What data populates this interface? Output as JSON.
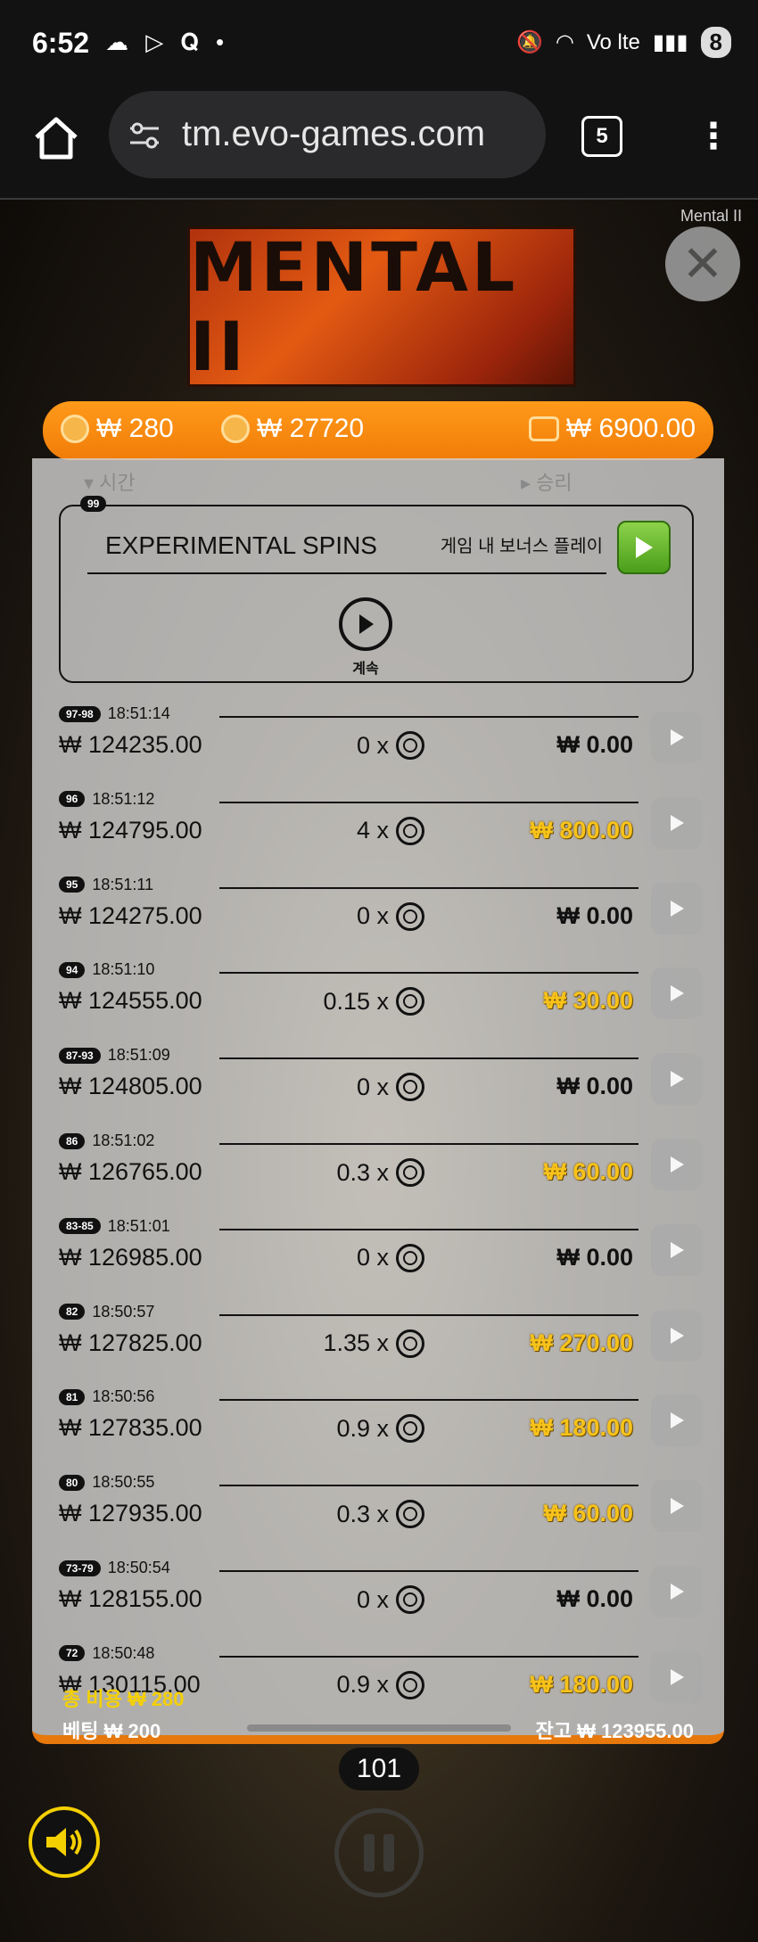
{
  "status_bar": {
    "time": "6:52",
    "notif_icons": "☁ ▷ 𝐐 •",
    "network": "Vo lte",
    "battery": "8"
  },
  "browser": {
    "url": "tm.evo-games.com",
    "tab_count": "5"
  },
  "game": {
    "name": "Mental II",
    "logo_text": "MENTAL II",
    "topbar": {
      "bet_amount": "₩ 280",
      "max_win": "₩ 27720",
      "wallet_balance": "₩ 6900.00"
    },
    "history": {
      "sort_time_label": "▾ 시간",
      "sort_win_label": "▸ 승리",
      "bonus": {
        "badge": "99",
        "title": "EXPERIMENTAL SPINS",
        "play_label": "게임 내 보너스 플레이",
        "continue_label": "계속"
      },
      "rows": [
        {
          "badge": "97-98",
          "time": "18:51:14",
          "balance": "₩ 124235.00",
          "mult": "0 x",
          "win": "₩ 0.00",
          "gold": false
        },
        {
          "badge": "96",
          "time": "18:51:12",
          "balance": "₩ 124795.00",
          "mult": "4 x",
          "win": "₩ 800.00",
          "gold": true
        },
        {
          "badge": "95",
          "time": "18:51:11",
          "balance": "₩ 124275.00",
          "mult": "0 x",
          "win": "₩ 0.00",
          "gold": false
        },
        {
          "badge": "94",
          "time": "18:51:10",
          "balance": "₩ 124555.00",
          "mult": "0.15 x",
          "win": "₩ 30.00",
          "gold": true
        },
        {
          "badge": "87-93",
          "time": "18:51:09",
          "balance": "₩ 124805.00",
          "mult": "0 x",
          "win": "₩ 0.00",
          "gold": false
        },
        {
          "badge": "86",
          "time": "18:51:02",
          "balance": "₩ 126765.00",
          "mult": "0.3 x",
          "win": "₩ 60.00",
          "gold": true
        },
        {
          "badge": "83-85",
          "time": "18:51:01",
          "balance": "₩ 126985.00",
          "mult": "0 x",
          "win": "₩ 0.00",
          "gold": false
        },
        {
          "badge": "82",
          "time": "18:50:57",
          "balance": "₩ 127825.00",
          "mult": "1.35 x",
          "win": "₩ 270.00",
          "gold": true
        },
        {
          "badge": "81",
          "time": "18:50:56",
          "balance": "₩ 127835.00",
          "mult": "0.9 x",
          "win": "₩ 180.00",
          "gold": true
        },
        {
          "badge": "80",
          "time": "18:50:55",
          "balance": "₩ 127935.00",
          "mult": "0.3 x",
          "win": "₩ 60.00",
          "gold": true
        },
        {
          "badge": "73-79",
          "time": "18:50:54",
          "balance": "₩ 128155.00",
          "mult": "0 x",
          "win": "₩ 0.00",
          "gold": false
        },
        {
          "badge": "72",
          "time": "18:50:48",
          "balance": "₩ 130115.00",
          "mult": "0.9 x",
          "win": "₩ 180.00",
          "gold": true
        }
      ]
    },
    "spin_count": "101",
    "total_cost_label": "총 비용  ₩ 280",
    "bet_label": "베팅  ₩ 200",
    "balance_label": "잔고  ₩ 123955.00"
  }
}
